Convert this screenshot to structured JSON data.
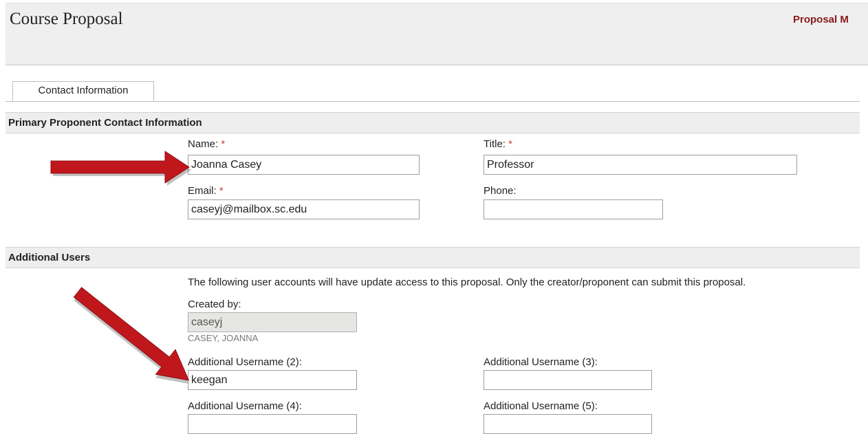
{
  "header": {
    "title": "Course Proposal",
    "link_label": "Proposal M"
  },
  "tabs": [
    {
      "label": "Contact Information"
    }
  ],
  "primary": {
    "section_title": "Primary Proponent Contact Information",
    "required_marker": "*",
    "name": {
      "label": "Name:",
      "value": "Joanna Casey"
    },
    "title": {
      "label": "Title:",
      "value": "Professor"
    },
    "email": {
      "label": "Email:",
      "value": "caseyj@mailbox.sc.edu"
    },
    "phone": {
      "label": "Phone:",
      "value": ""
    }
  },
  "additional": {
    "section_title": "Additional Users",
    "note": "The following user accounts will have update access to this proposal. Only the creator/proponent can submit this proposal.",
    "created_by": {
      "label": "Created by:",
      "value": "caseyj",
      "full_name": "CASEY, JOANNA"
    },
    "users": [
      {
        "label": "Additional Username (2):",
        "value": "keegan"
      },
      {
        "label": "Additional Username (3):",
        "value": ""
      },
      {
        "label": "Additional Username (4):",
        "value": ""
      },
      {
        "label": "Additional Username (5):",
        "value": ""
      }
    ]
  },
  "colors": {
    "accent_link": "#8b1a1a",
    "annotation_arrow": "#c0171d",
    "required": "#cc3b3b"
  }
}
